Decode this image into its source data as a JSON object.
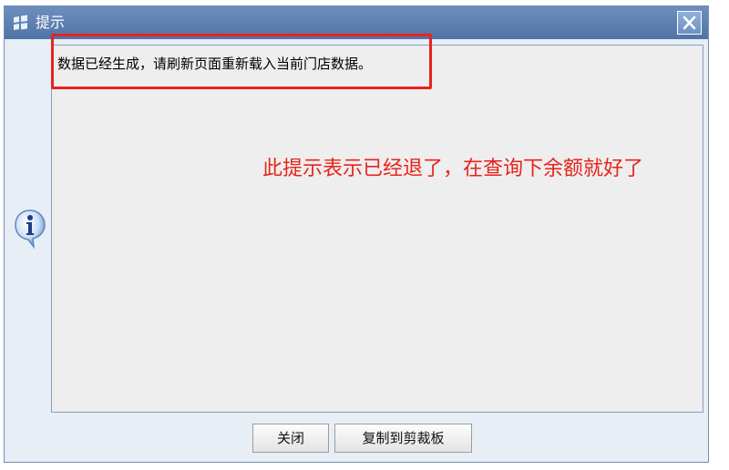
{
  "window": {
    "title": "提示"
  },
  "dialog": {
    "message": "数据已经生成，请刷新页面重新载入当前门店数据。"
  },
  "annotation": {
    "text": "此提示表示已经退了，在查询下余额就好了",
    "color": "#e8231b"
  },
  "buttons": {
    "close_label": "关闭",
    "copy_label": "复制到剪裁板"
  },
  "icons": {
    "title": "app-flags-icon",
    "close": "close-icon",
    "info": "info-icon"
  },
  "colors": {
    "titlebar": "#5a7fb1",
    "content_bg": "#eeeeee",
    "highlight": "#e8231b"
  }
}
